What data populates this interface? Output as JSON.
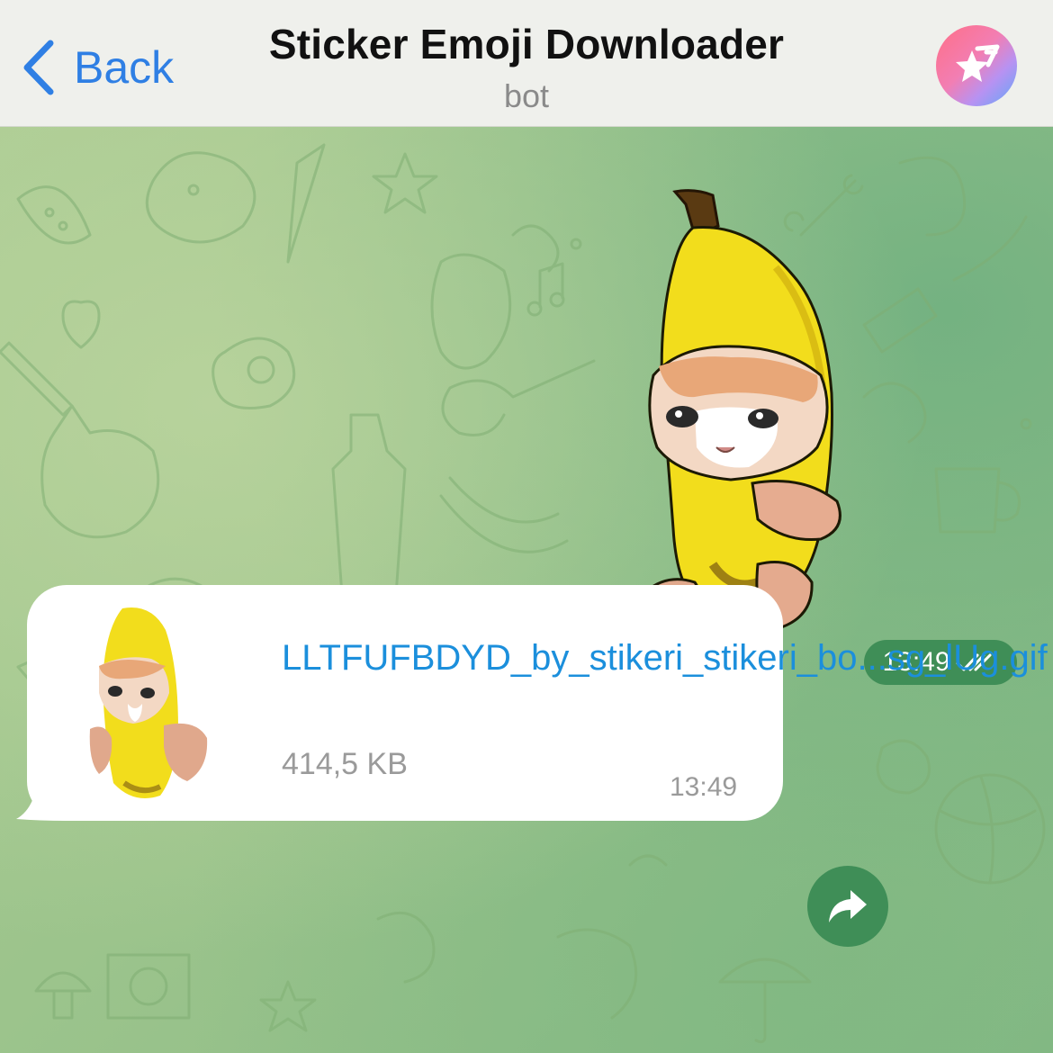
{
  "header": {
    "back_label": "Back",
    "title": "Sticker Emoji Downloader",
    "subtitle": "bot",
    "back_icon": "chevron-left-icon",
    "avatar_icon": "bot-avatar-star-icon"
  },
  "messages": {
    "sticker": {
      "time": "13:49",
      "status_icon": "double-check-icon",
      "content": "banana-cat-sticker"
    },
    "file": {
      "name": "LLTFUFBDYD_by_stikeri_stikeri_bo...sg_lUg.gif",
      "size": "414,5 KB",
      "time": "13:49",
      "forward_icon": "forward-arrow-icon"
    }
  },
  "colors": {
    "accent": "#2f7fe4",
    "link": "#1b8fdc",
    "bubble_green": "#3f8e57",
    "chat_bg": "#9cc48e",
    "header_bg": "#eff0ec"
  }
}
